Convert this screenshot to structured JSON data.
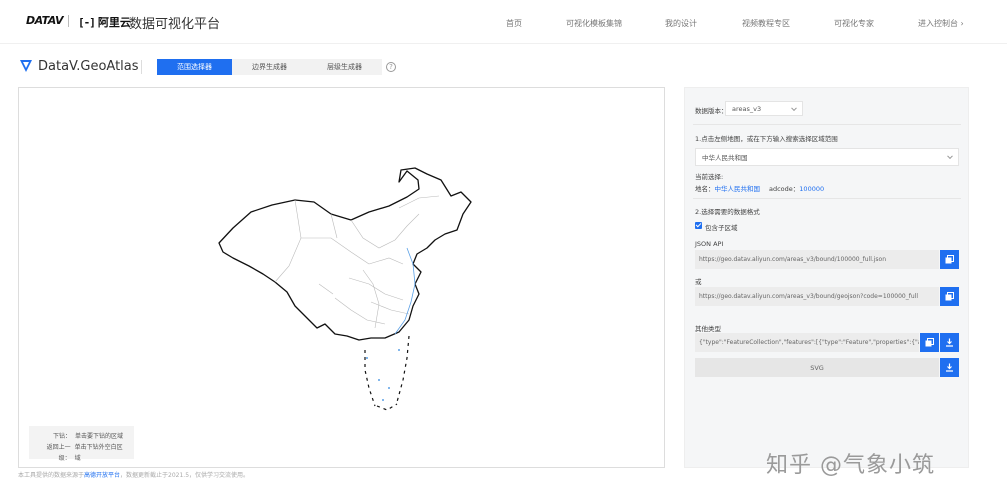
{
  "topnav": {
    "datav_logo": "DATAV",
    "aliyun_logo": "阿里云",
    "platform_title": "数据可视化平台",
    "links": [
      "首页",
      "可视化模板集锦",
      "我的设计",
      "视频教程专区",
      "可视化专家",
      "进入控制台 ›"
    ]
  },
  "app": {
    "title": "DataV.GeoAtlas",
    "tabs": [
      "范围选择器",
      "边界生成器",
      "层级生成器"
    ],
    "help": "?"
  },
  "map": {
    "tip_rows": [
      {
        "key": "下钻：",
        "value": "单击要下钻的区域"
      },
      {
        "key": "返回上一级：",
        "value": "单击下钻外空白区域"
      }
    ],
    "footnote_prefix": "本工具提供的数据来源于",
    "footnote_link": "高德开放平台",
    "footnote_suffix": "，数据更新截止于2021.5，仅供学习交流使用。"
  },
  "side": {
    "version_label": "数据版本：",
    "version_value": "areas_v3",
    "step1_label": "1.点击左侧地图，或在下方输入搜索选择区域范围",
    "region_select": "中华人民共和国",
    "current_label": "当前选择:",
    "region_key": "地名：",
    "region_value": "中华人民共和国",
    "adcode_key": "adcode：",
    "adcode_value": "100000",
    "step2_label": "2.选择需要的数据格式",
    "include_sub": "包含子区域",
    "json_api_label": "JSON API",
    "json_api_url": "https://geo.datav.aliyun.com/areas_v3/bound/100000_full.json",
    "or_label": "或",
    "geojson_url": "https://geo.datav.aliyun.com/areas_v3/bound/geojson?code=100000_full",
    "other_label": "其他类型",
    "geo_text": "{\"type\":\"FeatureCollection\",\"features\":[{\"type\":\"Feature\",\"properties\":{\"adcode",
    "svg_label": "SVG"
  },
  "watermark": "知乎 @气象小筑",
  "colors": {
    "accent": "#1f6ff0",
    "panel": "#f5f6f7"
  }
}
